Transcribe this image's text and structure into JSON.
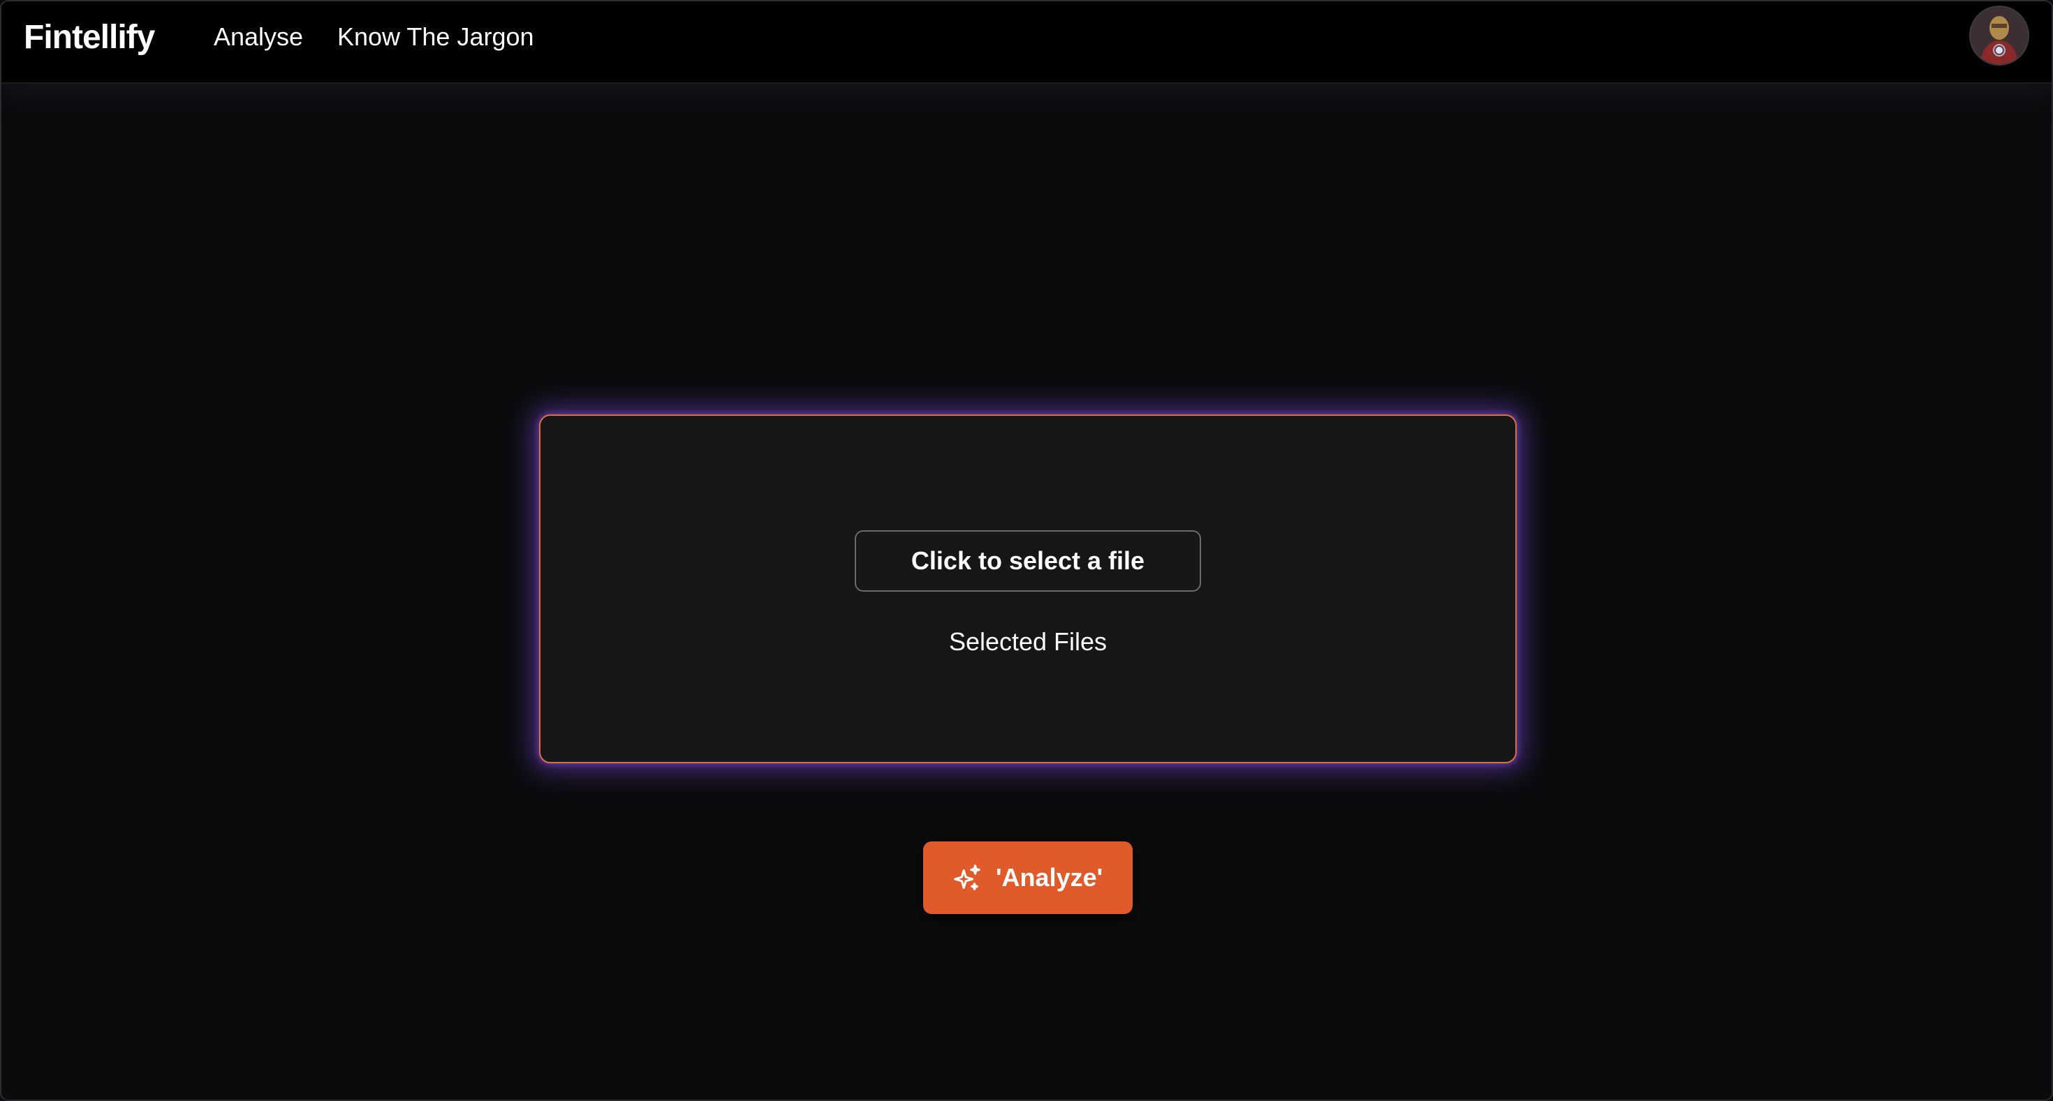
{
  "navbar": {
    "brand": "Fintellify",
    "links": [
      {
        "label": "Analyse"
      },
      {
        "label": "Know The Jargon"
      }
    ],
    "avatar_icon": "user-avatar"
  },
  "upload": {
    "select_button_label": "Click to select a file",
    "selected_files_label": "Selected Files",
    "border_color": "#d9703f",
    "glow_color": "#7d48dc"
  },
  "action": {
    "analyze_label": "'Analyze'",
    "analyze_icon": "sparkles-icon",
    "button_color": "#e05a2a"
  },
  "theme": {
    "background": "#0b0b0e",
    "navbar_background": "#000000"
  }
}
